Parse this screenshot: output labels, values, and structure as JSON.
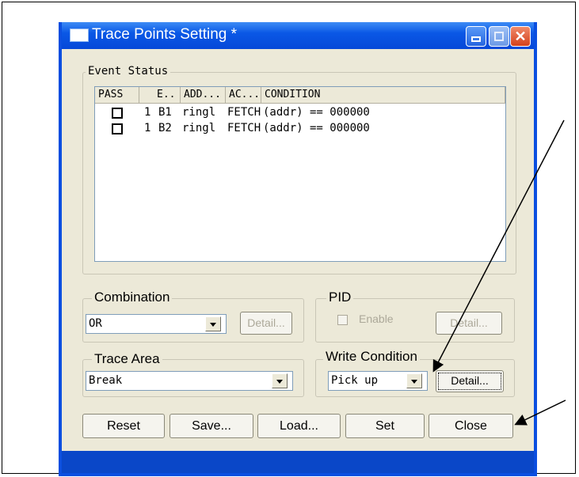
{
  "window": {
    "title": "Trace Points Setting *"
  },
  "event_status": {
    "label": "Event Status",
    "columns": [
      "PASS",
      "E..",
      "ADD...",
      "AC...",
      "CONDITION"
    ],
    "rows": [
      {
        "count": "1",
        "event": "B1",
        "address": "ringl",
        "access": "FETCH",
        "condition": "(addr) == 000000"
      },
      {
        "count": "1",
        "event": "B2",
        "address": "ringl",
        "access": "FETCH",
        "condition": "(addr) == 000000"
      }
    ]
  },
  "combination": {
    "label": "Combination",
    "value": "OR",
    "detail": "Detail..."
  },
  "pid": {
    "label": "PID",
    "enable": "Enable",
    "detail": "Detail..."
  },
  "trace_area": {
    "label": "Trace Area",
    "value": "Break"
  },
  "write_condition": {
    "label": "Write Condition",
    "value": "Pick up",
    "detail": "Detail..."
  },
  "buttons": {
    "reset": "Reset",
    "save": "Save...",
    "load": "Load...",
    "set": "Set",
    "close": "Close"
  },
  "colors": {
    "title_bar": "#0a58e6",
    "dialog_bg": "#ece9d8",
    "close_button": "#d4411c"
  },
  "icons": [
    "window-icon",
    "minimize-icon",
    "maximize-icon",
    "close-icon",
    "dropdown-arrow-icon"
  ]
}
